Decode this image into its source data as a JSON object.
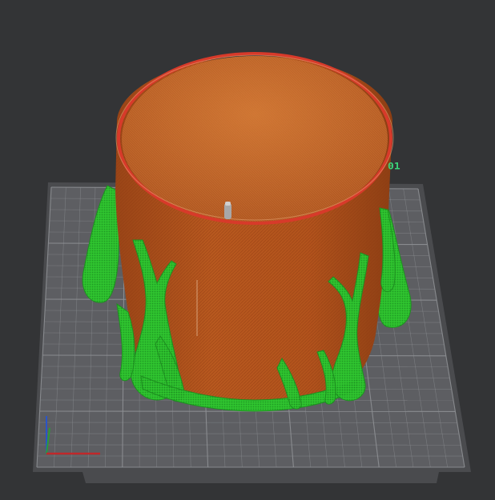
{
  "viewport": {
    "background_color": "#333436",
    "bed": {
      "edge_text": "01",
      "plate_color": "#5d5e62",
      "grid_color": "#8e9094",
      "frame_color": "#4a4b4e"
    },
    "model": {
      "body_color": "#b5561e",
      "inner_color": "#c86a2a",
      "rim_color": "#d73a2a",
      "support_color": "#2fc42f",
      "support_dark": "#1e8f20"
    },
    "axes": {
      "x_color": "#c0282a",
      "y_color": "#2b9a3a",
      "z_color": "#2a55c8"
    }
  }
}
